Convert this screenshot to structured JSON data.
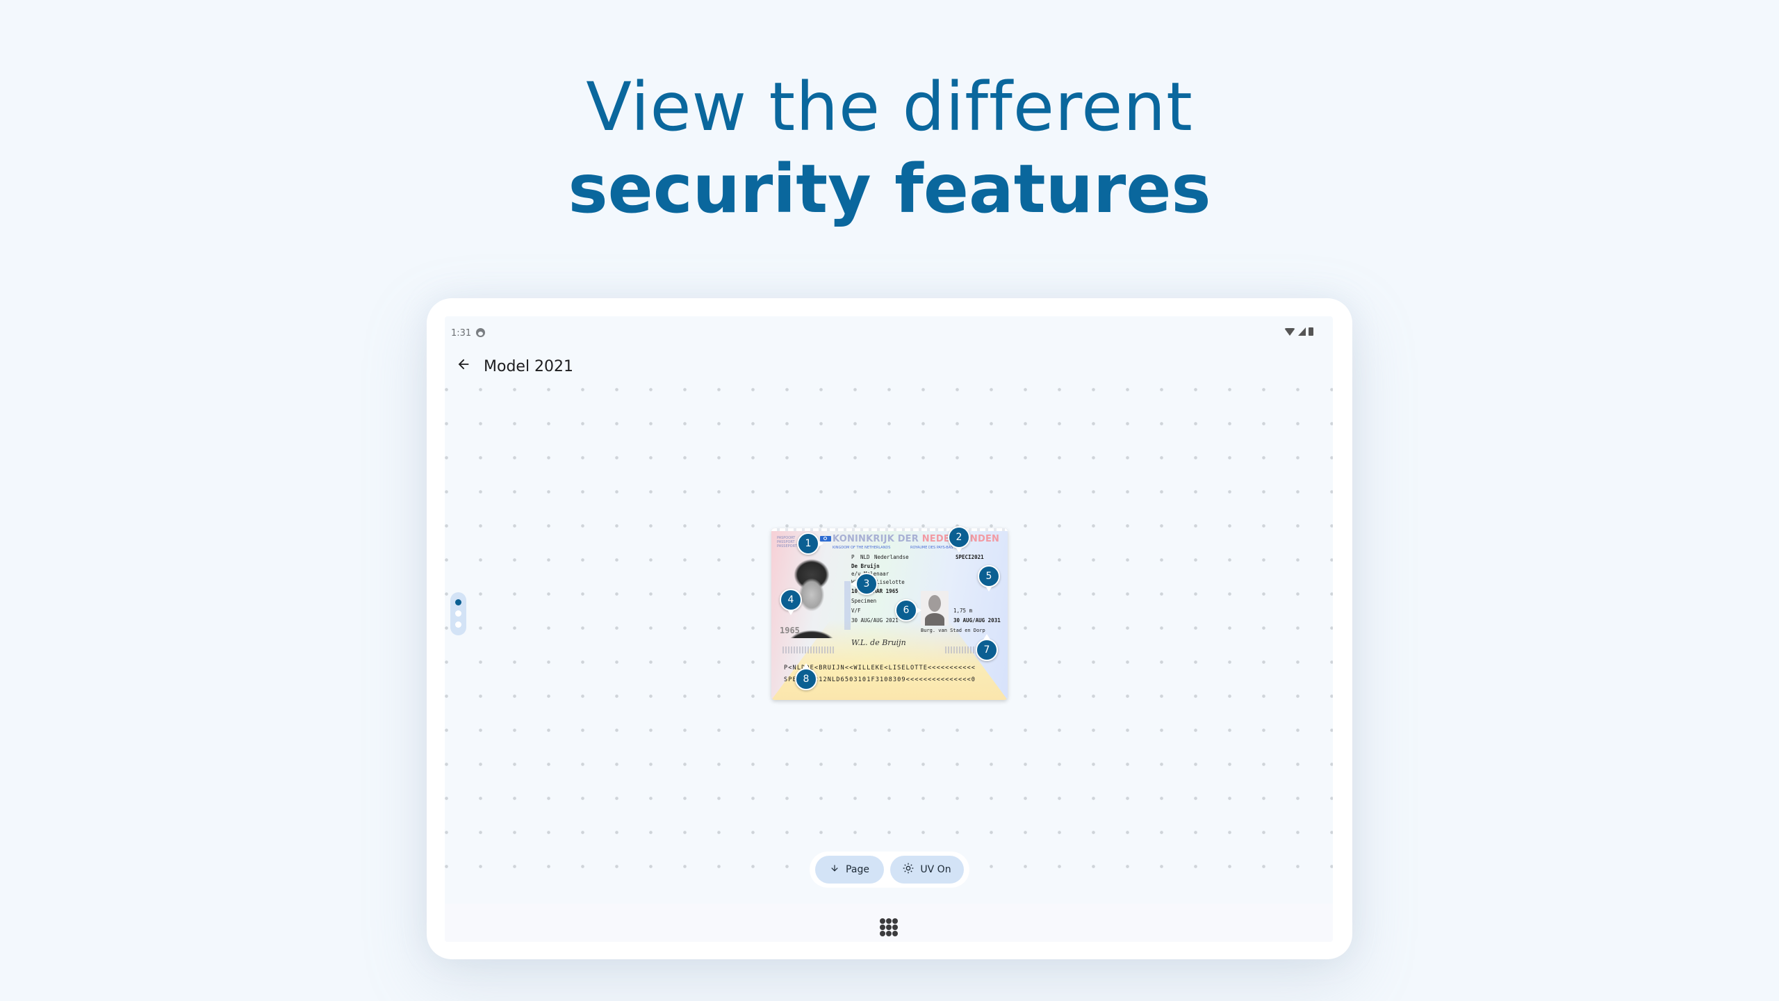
{
  "headline": {
    "line1": "View the different",
    "line2": "security features",
    "color": "#0a679d"
  },
  "device": {
    "status_bar": {
      "time": "1:31",
      "notification_icon": "face-icon",
      "system_icons": [
        "wifi-icon",
        "signal-icon",
        "battery-icon"
      ]
    },
    "app_bar": {
      "back_icon": "arrow-left-icon",
      "title": "Model 2021"
    },
    "document": {
      "header": "KONINKRIJK DER NEDERLANDEN",
      "header_sub_left": "KINGDOM OF THE NETHERLANDS",
      "header_sub_right": "ROYAUME DES PAYS-BAS",
      "left_labels": [
        "PASPOORT",
        "PASSPORT",
        "PASSEPORT"
      ],
      "type": "P",
      "code": "NLD",
      "nationality": "Nederlandse",
      "document_number": "SPECI2021",
      "surname": "De Bruijn",
      "spouse_line": "e/v Molenaar",
      "given_names": "Willeke Liselotte",
      "date_of_birth": "10 MAA/MAR 1965",
      "place_of_birth": "Specimen",
      "sex": "V/F",
      "date_of_issue": "30 AUG/AUG 2021",
      "height": "1,75 m",
      "date_of_expiry": "30 AUG/AUG 2031",
      "authority": "Burg. van Stad en Dorp",
      "ghost_year": "1965",
      "signature": "W.L. de Bruijn",
      "mrz_line1": "P<NLDDE<BRUIJN<<WILLEKE<LISELOTTE<<<<<<<<<<<",
      "mrz_line2": "SPECI20212NLD6503101F3108309<<<<<<<<<<<<<<<0"
    },
    "markers": [
      {
        "number": "1",
        "pointer": "right"
      },
      {
        "number": "2",
        "pointer": "down"
      },
      {
        "number": "3",
        "pointer": "left"
      },
      {
        "number": "4",
        "pointer": "down"
      },
      {
        "number": "5",
        "pointer": "down"
      },
      {
        "number": "6",
        "pointer": "right"
      },
      {
        "number": "7",
        "pointer": "up"
      },
      {
        "number": "8",
        "pointer": "up"
      }
    ],
    "page_indicator": {
      "pages": 3,
      "current": 1,
      "active_color": "#0b5f92"
    },
    "controls": {
      "page_button": {
        "label": "Page",
        "icon": "arrow-down-icon"
      },
      "uv_button": {
        "label": "UV On",
        "icon": "sun-icon"
      }
    },
    "nav_bar": {
      "icon": "app-grid-icon"
    }
  }
}
